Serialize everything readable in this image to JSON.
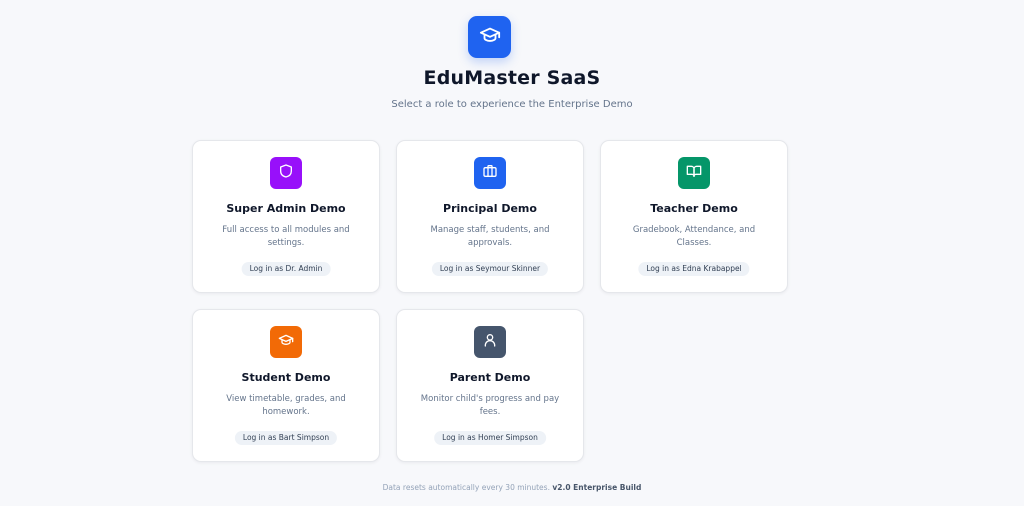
{
  "app": {
    "title": "EduMaster SaaS",
    "subtitle": "Select a role to experience the Enterprise Demo",
    "logo_icon": "graduation-cap-icon",
    "logo_color": "#1f63f0"
  },
  "roles": [
    {
      "title": "Super Admin Demo",
      "description": "Full access to all modules and settings.",
      "login_label": "Log in as Dr. Admin",
      "icon": "shield-icon",
      "color": "#9810fa"
    },
    {
      "title": "Principal Demo",
      "description": "Manage staff, students, and approvals.",
      "login_label": "Log in as Seymour Skinner",
      "icon": "briefcase-icon",
      "color": "#1f63f0"
    },
    {
      "title": "Teacher Demo",
      "description": "Gradebook, Attendance, and Classes.",
      "login_label": "Log in as Edna Krabappel",
      "icon": "book-open-icon",
      "color": "#059669"
    },
    {
      "title": "Student Demo",
      "description": "View timetable, grades, and homework.",
      "login_label": "Log in as Bart Simpson",
      "icon": "graduation-cap-icon",
      "color": "#f26a06"
    },
    {
      "title": "Parent Demo",
      "description": "Monitor child's progress and pay fees.",
      "login_label": "Log in as Homer Simpson",
      "icon": "user-icon",
      "color": "#45556c"
    }
  ],
  "footer": {
    "note": "Data resets automatically every 30 minutes.",
    "version": "v2.0 Enterprise Build"
  }
}
